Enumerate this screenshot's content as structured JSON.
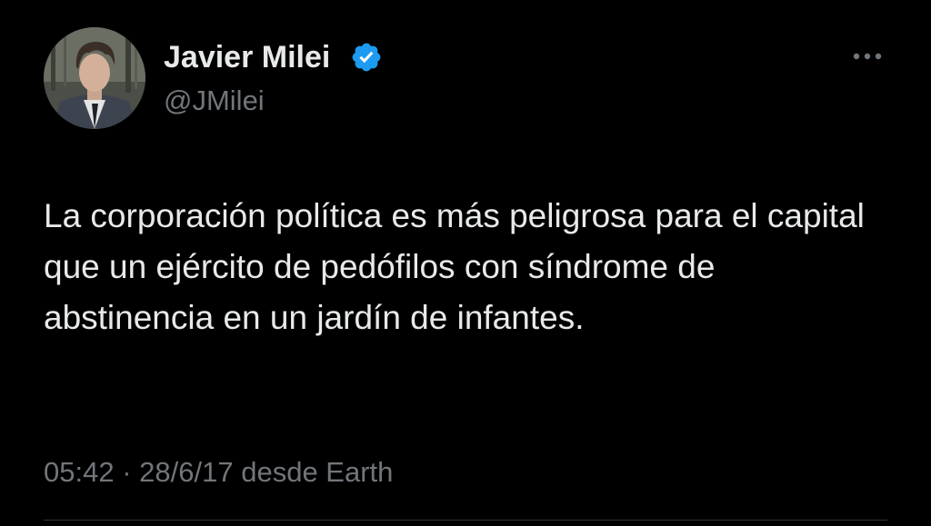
{
  "tweet": {
    "author": {
      "display_name": "Javier Milei",
      "handle": "@JMilei",
      "verified": true
    },
    "text": "La corporación política es más peligrosa para el capital que un ejército de pedófilos con síndrome de abstinencia en un jardín de infantes.",
    "time": "05:42",
    "separator": "·",
    "date": "28/6/17",
    "source": "desde Earth"
  },
  "icons": {
    "verified": "verified-badge-icon",
    "more": "more-options-icon"
  },
  "colors": {
    "background": "#000000",
    "primary_text": "#e7e9ea",
    "secondary_text": "#71767b",
    "verified_blue": "#1d9bf0",
    "divider": "#2f3336"
  }
}
